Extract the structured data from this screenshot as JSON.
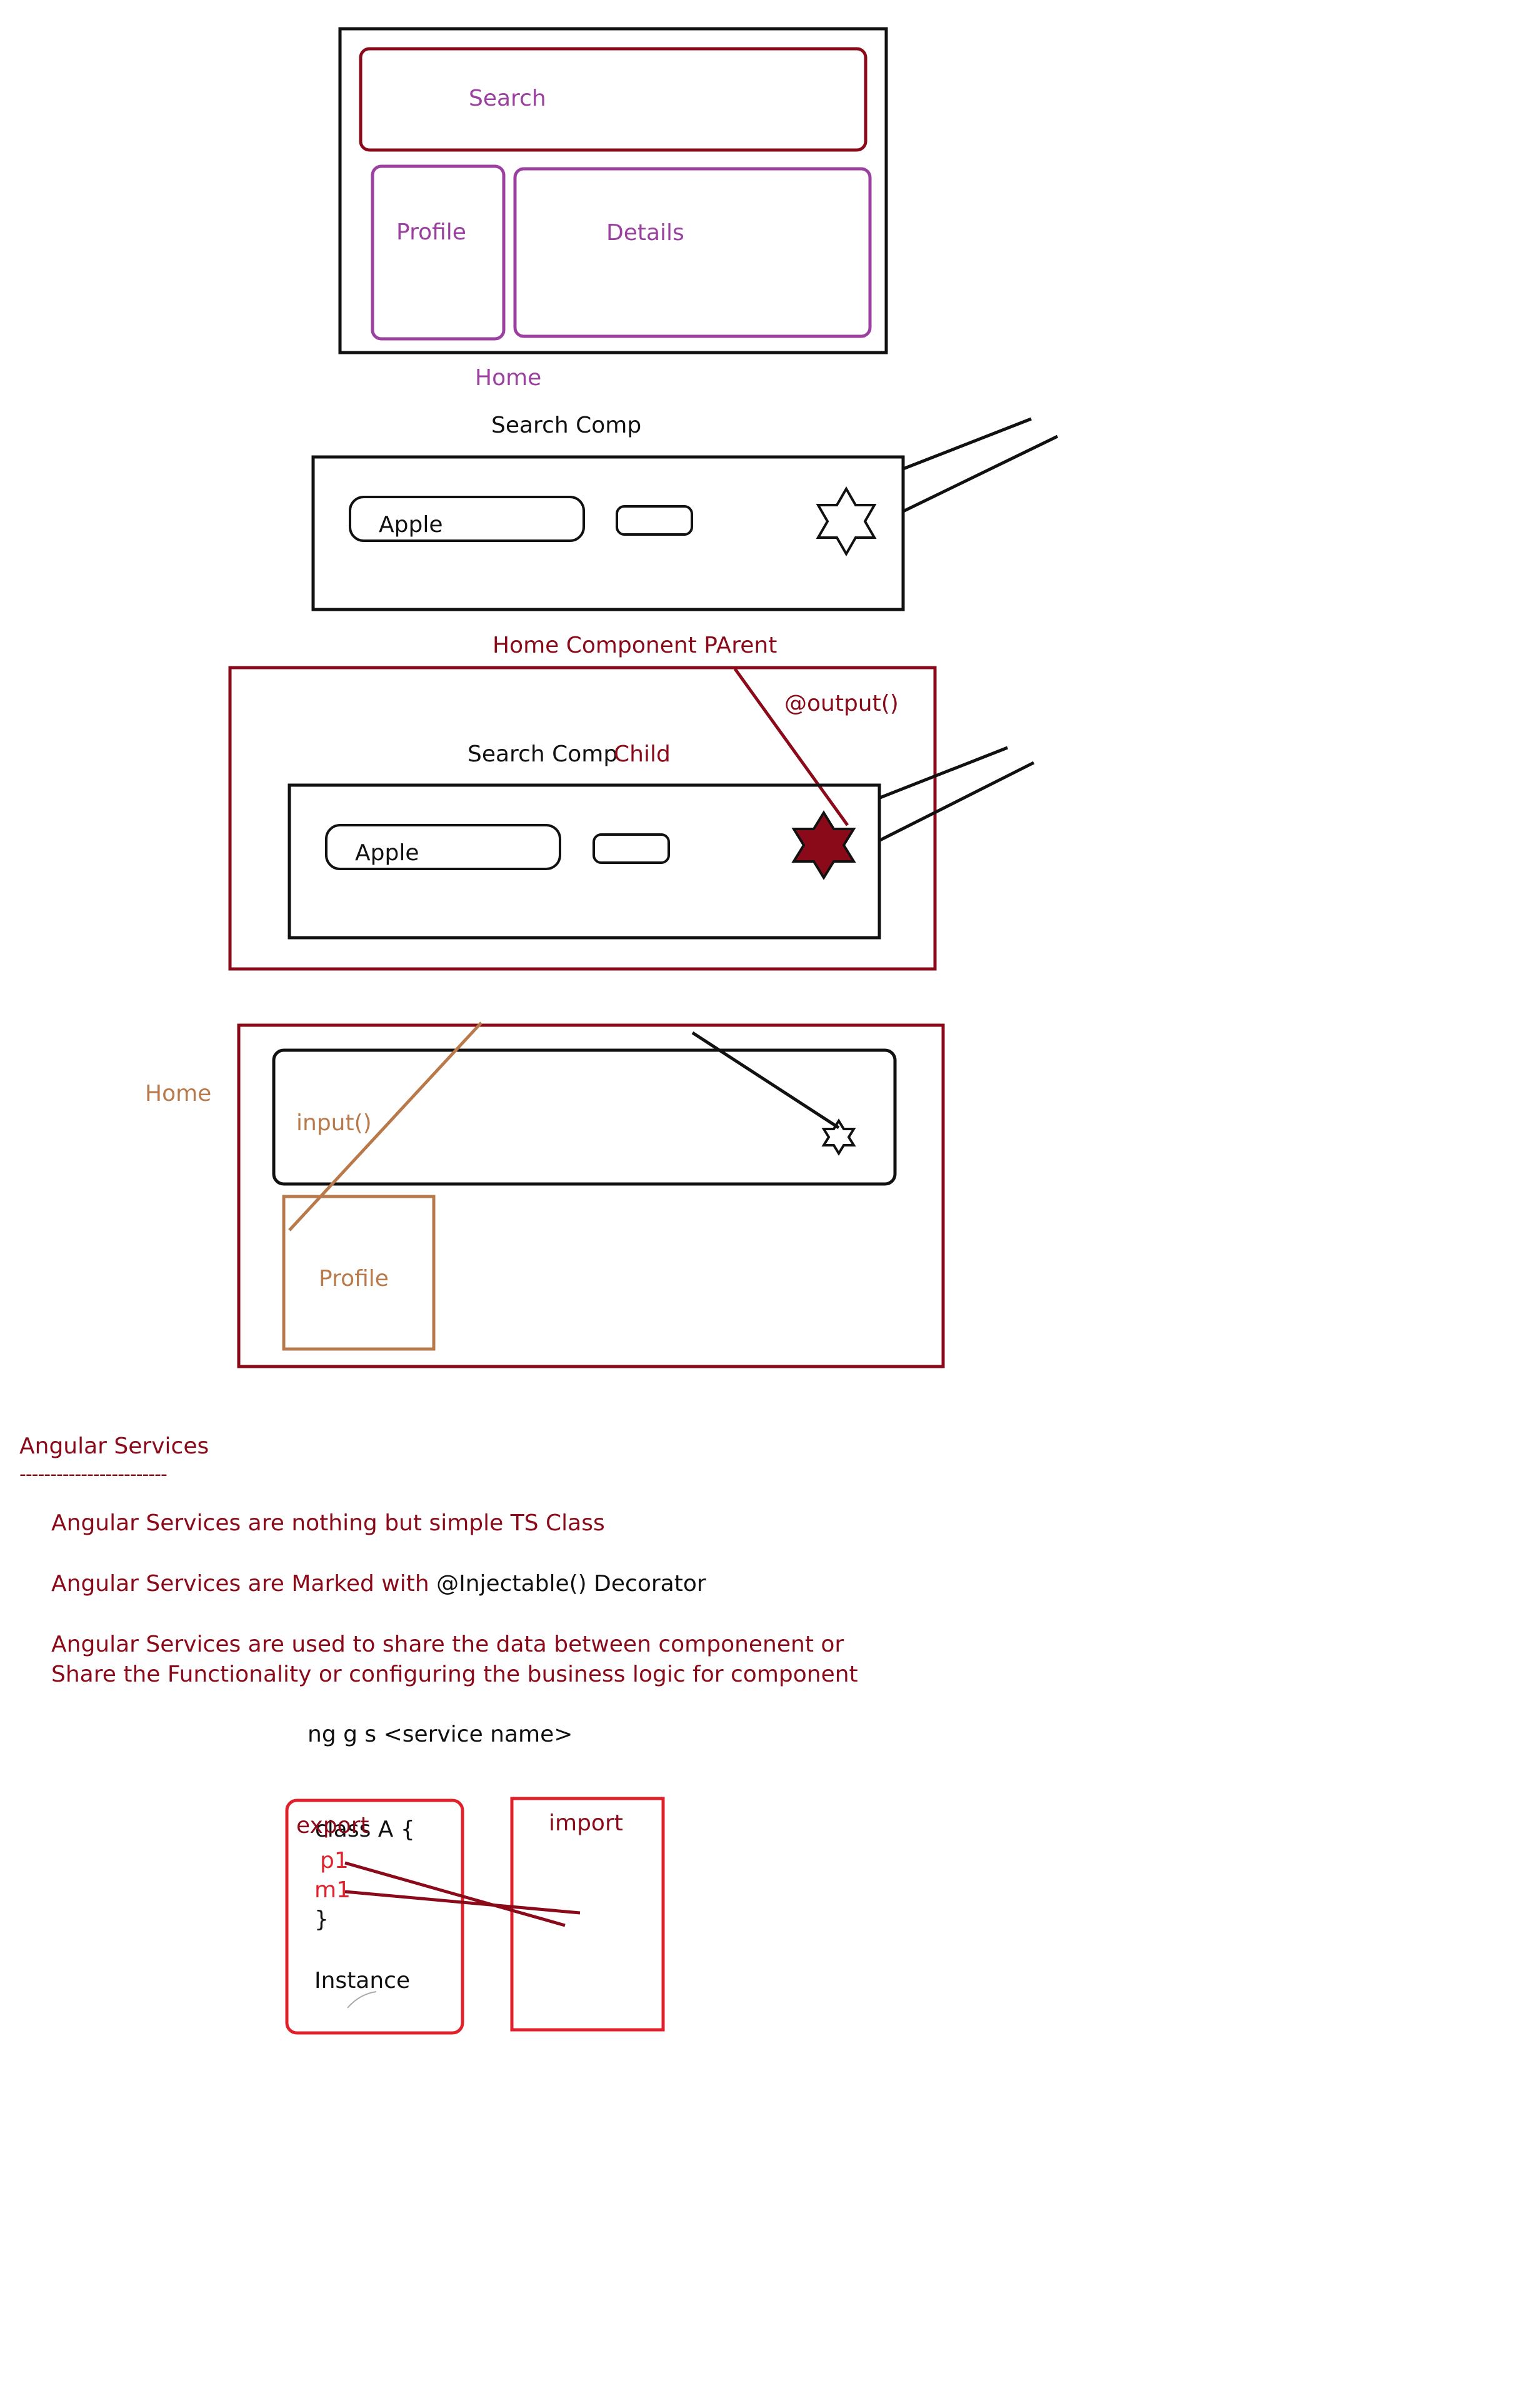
{
  "diagram1": {
    "search_label": "Search",
    "profile_label": "Profile",
    "details_label": "Details",
    "home_label": "Home"
  },
  "diagram2": {
    "title": "Search Comp",
    "apple_label": "Apple"
  },
  "diagram3": {
    "title": "Home Component  PArent",
    "output_label": "@output()",
    "search_comp_label": "Search Comp",
    "child_label": "Child",
    "apple_label": "Apple"
  },
  "diagram4": {
    "home_label": "Home",
    "input_label": "input()",
    "profile_label": "Profile"
  },
  "notes": {
    "heading": "Angular Services",
    "underline": "------------------------",
    "line1": "Angular Services are nothing but simple TS Class",
    "line2_red": "Angular Services are Marked with ",
    "line2_black": "@Injectable() Decorator",
    "line3": "Angular Services are used to share the data between componenent or",
    "line4": "Share the Functionality or configuring the business logic for component",
    "command": "ng g s <service name>"
  },
  "diagram5": {
    "export_label": "export",
    "class_label": "class A {",
    "p1_label": "p1",
    "m1_label": "m1",
    "brace_label": "}",
    "instance_label": "Instance",
    "import_label": "import"
  },
  "colors": {
    "purple_text": "#9b3fa0",
    "dark_red": "#8b0a1a",
    "brown": "#b87a4b",
    "bright_red": "#e0212b"
  }
}
